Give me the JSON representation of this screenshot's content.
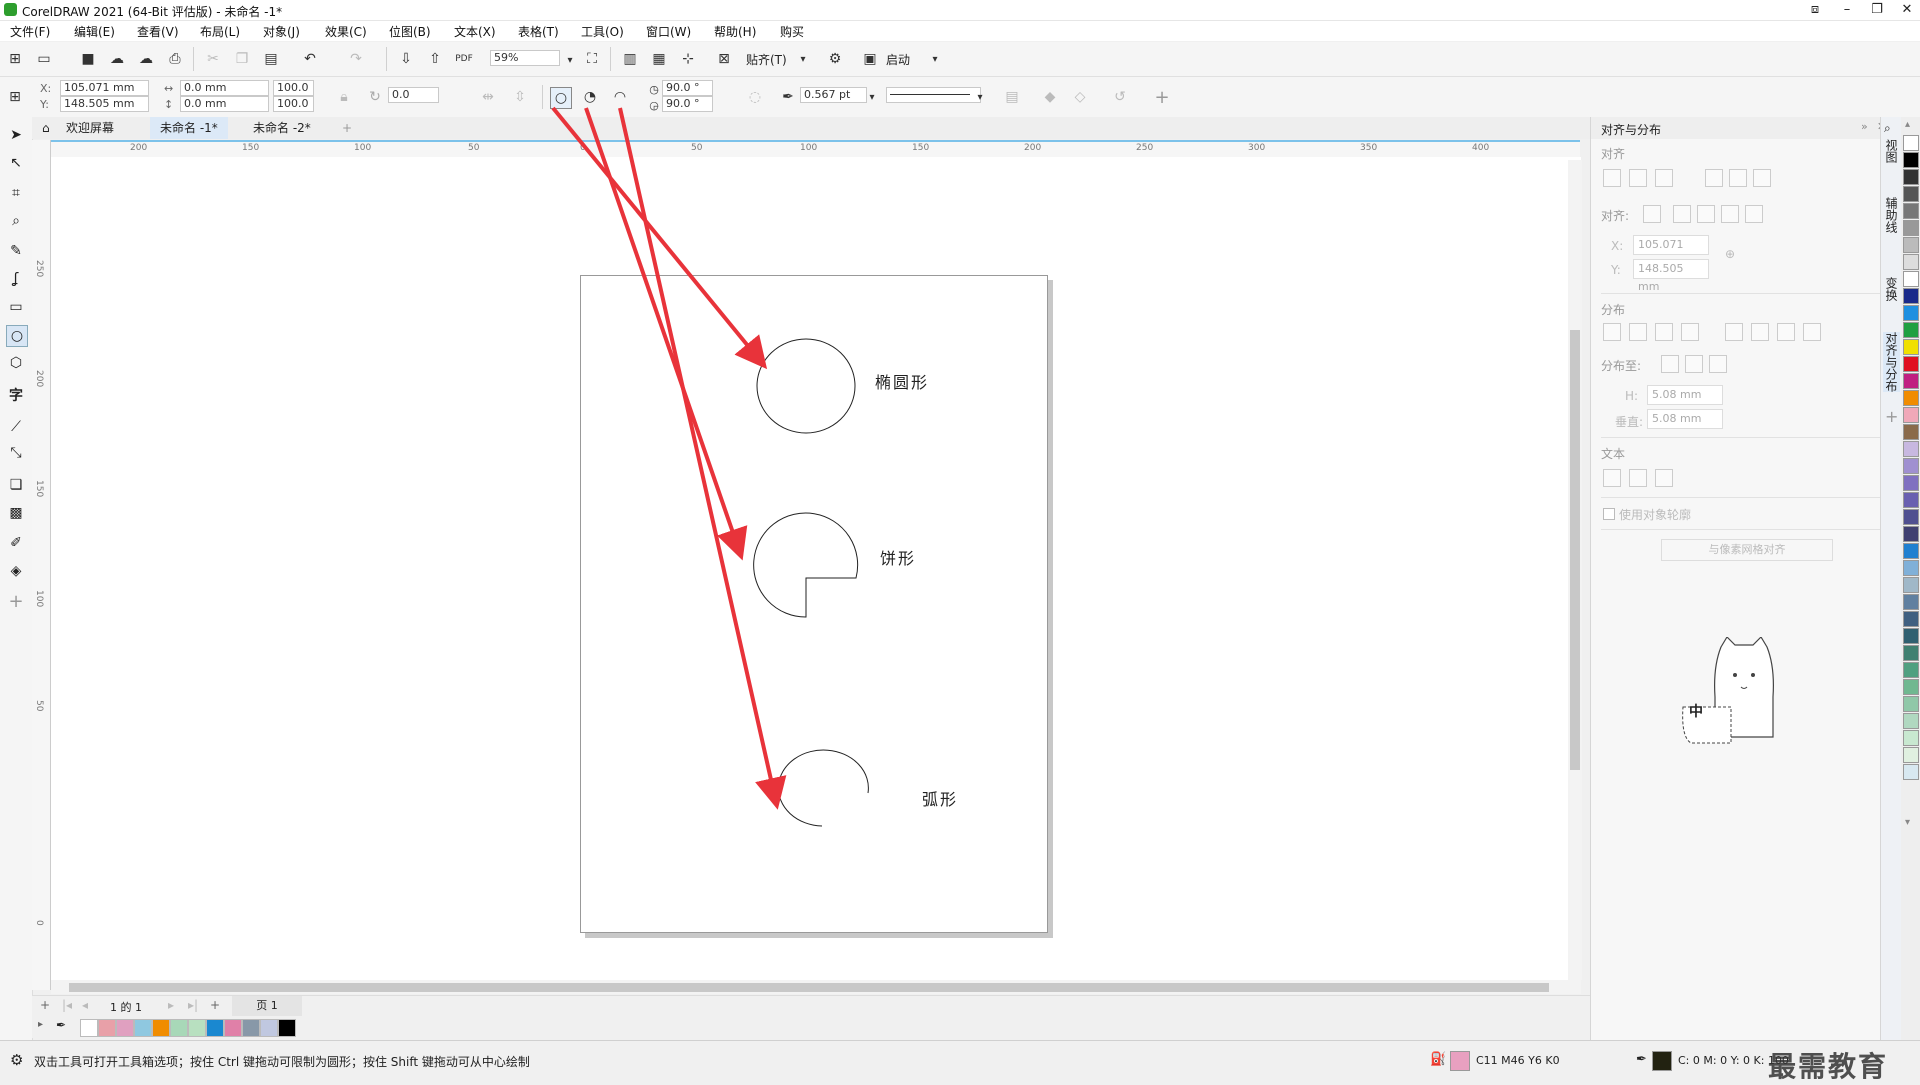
{
  "window": {
    "title": "CorelDRAW 2021 (64-Bit 评估版) - 未命名 -1*"
  },
  "menu": [
    "文件(F)",
    "编辑(E)",
    "查看(V)",
    "布局(L)",
    "对象(J)",
    "效果(C)",
    "位图(B)",
    "文本(X)",
    "表格(T)",
    "工具(O)",
    "窗口(W)",
    "帮助(H)",
    "购买"
  ],
  "toolbar": {
    "zoom": "59%",
    "snap_label": "贴齐(T)",
    "launch_label": "启动"
  },
  "property_bar": {
    "x": "105.071 mm",
    "y": "148.505 mm",
    "width": "0.0 mm",
    "height": "0.0 mm",
    "scale_x": "100.0",
    "scale_y": "100.0",
    "rotation": "0.0",
    "start_angle": "90.0 °",
    "end_angle": "90.0 °",
    "outline_width": "0.567 pt",
    "x_label": "X:",
    "y_label": "Y:"
  },
  "tabs": [
    "欢迎屏幕",
    "未命名 -1*",
    "未命名 -2*"
  ],
  "ruler": {
    "h_ticks": [
      "200",
      "150",
      "100",
      "50",
      "0",
      "50",
      "100",
      "150",
      "200",
      "250",
      "300",
      "350",
      "400"
    ],
    "v_ticks": [
      "250",
      "200",
      "150",
      "100",
      "50",
      "0"
    ]
  },
  "shapes": {
    "ellipse_label": "椭圆形",
    "pie_label": "饼形",
    "arc_label": "弧形"
  },
  "page_nav": {
    "page_info": "1 的 1",
    "page_tab": "页 1"
  },
  "docker": {
    "title": "对齐与分布",
    "section_align": "对齐",
    "align_to": "对齐:",
    "x_label": "X:",
    "x_value": "105.071 mm",
    "y_label": "Y:",
    "y_value": "148.505 mm",
    "section_distribute": "分布",
    "distribute_to": "分布至:",
    "h_label": "H:",
    "h_value": "5.08 mm",
    "v_label": "垂直:",
    "v_value": "5.08 mm",
    "section_text": "文本",
    "use_outline": "使用对象轮廓",
    "pixel_grid_button": "与像素网格对齐",
    "mascot_text": "中"
  },
  "vertical_tabs": [
    "视图",
    "辅助线",
    "变换",
    "对齐与分布"
  ],
  "status": {
    "hint": "双击工具可打开工具箱选项；按住 Ctrl 键拖动可限制为圆形；按住 Shift 键拖动可从中心绘制",
    "fill_color": "C11 M46 Y6 K0",
    "outline_color": "C: 0 M: 0 Y: 0 K: 100",
    "watermark": "最需教育"
  },
  "colors": {
    "fill_swatch": "#e8a0c0",
    "arrow": "#e8333a",
    "accent": "#2e9e2e"
  }
}
